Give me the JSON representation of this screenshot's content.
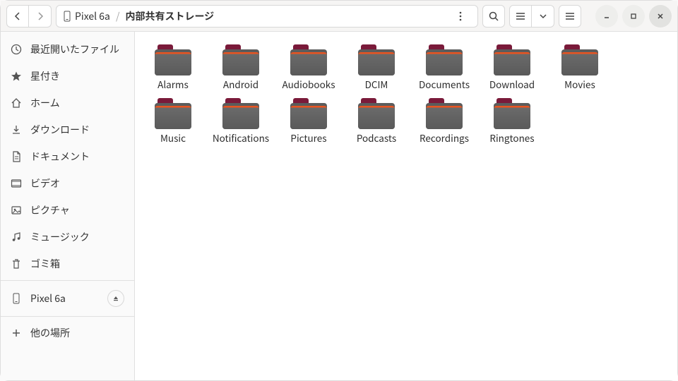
{
  "breadcrumb": {
    "device": "Pixel 6a",
    "location": "内部共有ストレージ"
  },
  "sidebar": {
    "items": [
      {
        "label": "最近開いたファイル",
        "icon": "clock-icon"
      },
      {
        "label": "星付き",
        "icon": "star-icon"
      },
      {
        "label": "ホーム",
        "icon": "home-icon"
      },
      {
        "label": "ダウンロード",
        "icon": "download-icon"
      },
      {
        "label": "ドキュメント",
        "icon": "document-icon"
      },
      {
        "label": "ビデオ",
        "icon": "video-icon"
      },
      {
        "label": "ピクチャ",
        "icon": "picture-icon"
      },
      {
        "label": "ミュージック",
        "icon": "music-icon"
      },
      {
        "label": "ゴミ箱",
        "icon": "trash-icon"
      }
    ],
    "device": {
      "label": "Pixel 6a",
      "icon": "phone-icon"
    },
    "other": {
      "label": "他の場所",
      "icon": "plus-icon"
    }
  },
  "folders": [
    {
      "name": "Alarms"
    },
    {
      "name": "Android"
    },
    {
      "name": "Audiobooks"
    },
    {
      "name": "DCIM"
    },
    {
      "name": "Documents"
    },
    {
      "name": "Download"
    },
    {
      "name": "Movies"
    },
    {
      "name": "Music"
    },
    {
      "name": "Notifications"
    },
    {
      "name": "Pictures"
    },
    {
      "name": "Podcasts"
    },
    {
      "name": "Recordings"
    },
    {
      "name": "Ringtones"
    }
  ]
}
